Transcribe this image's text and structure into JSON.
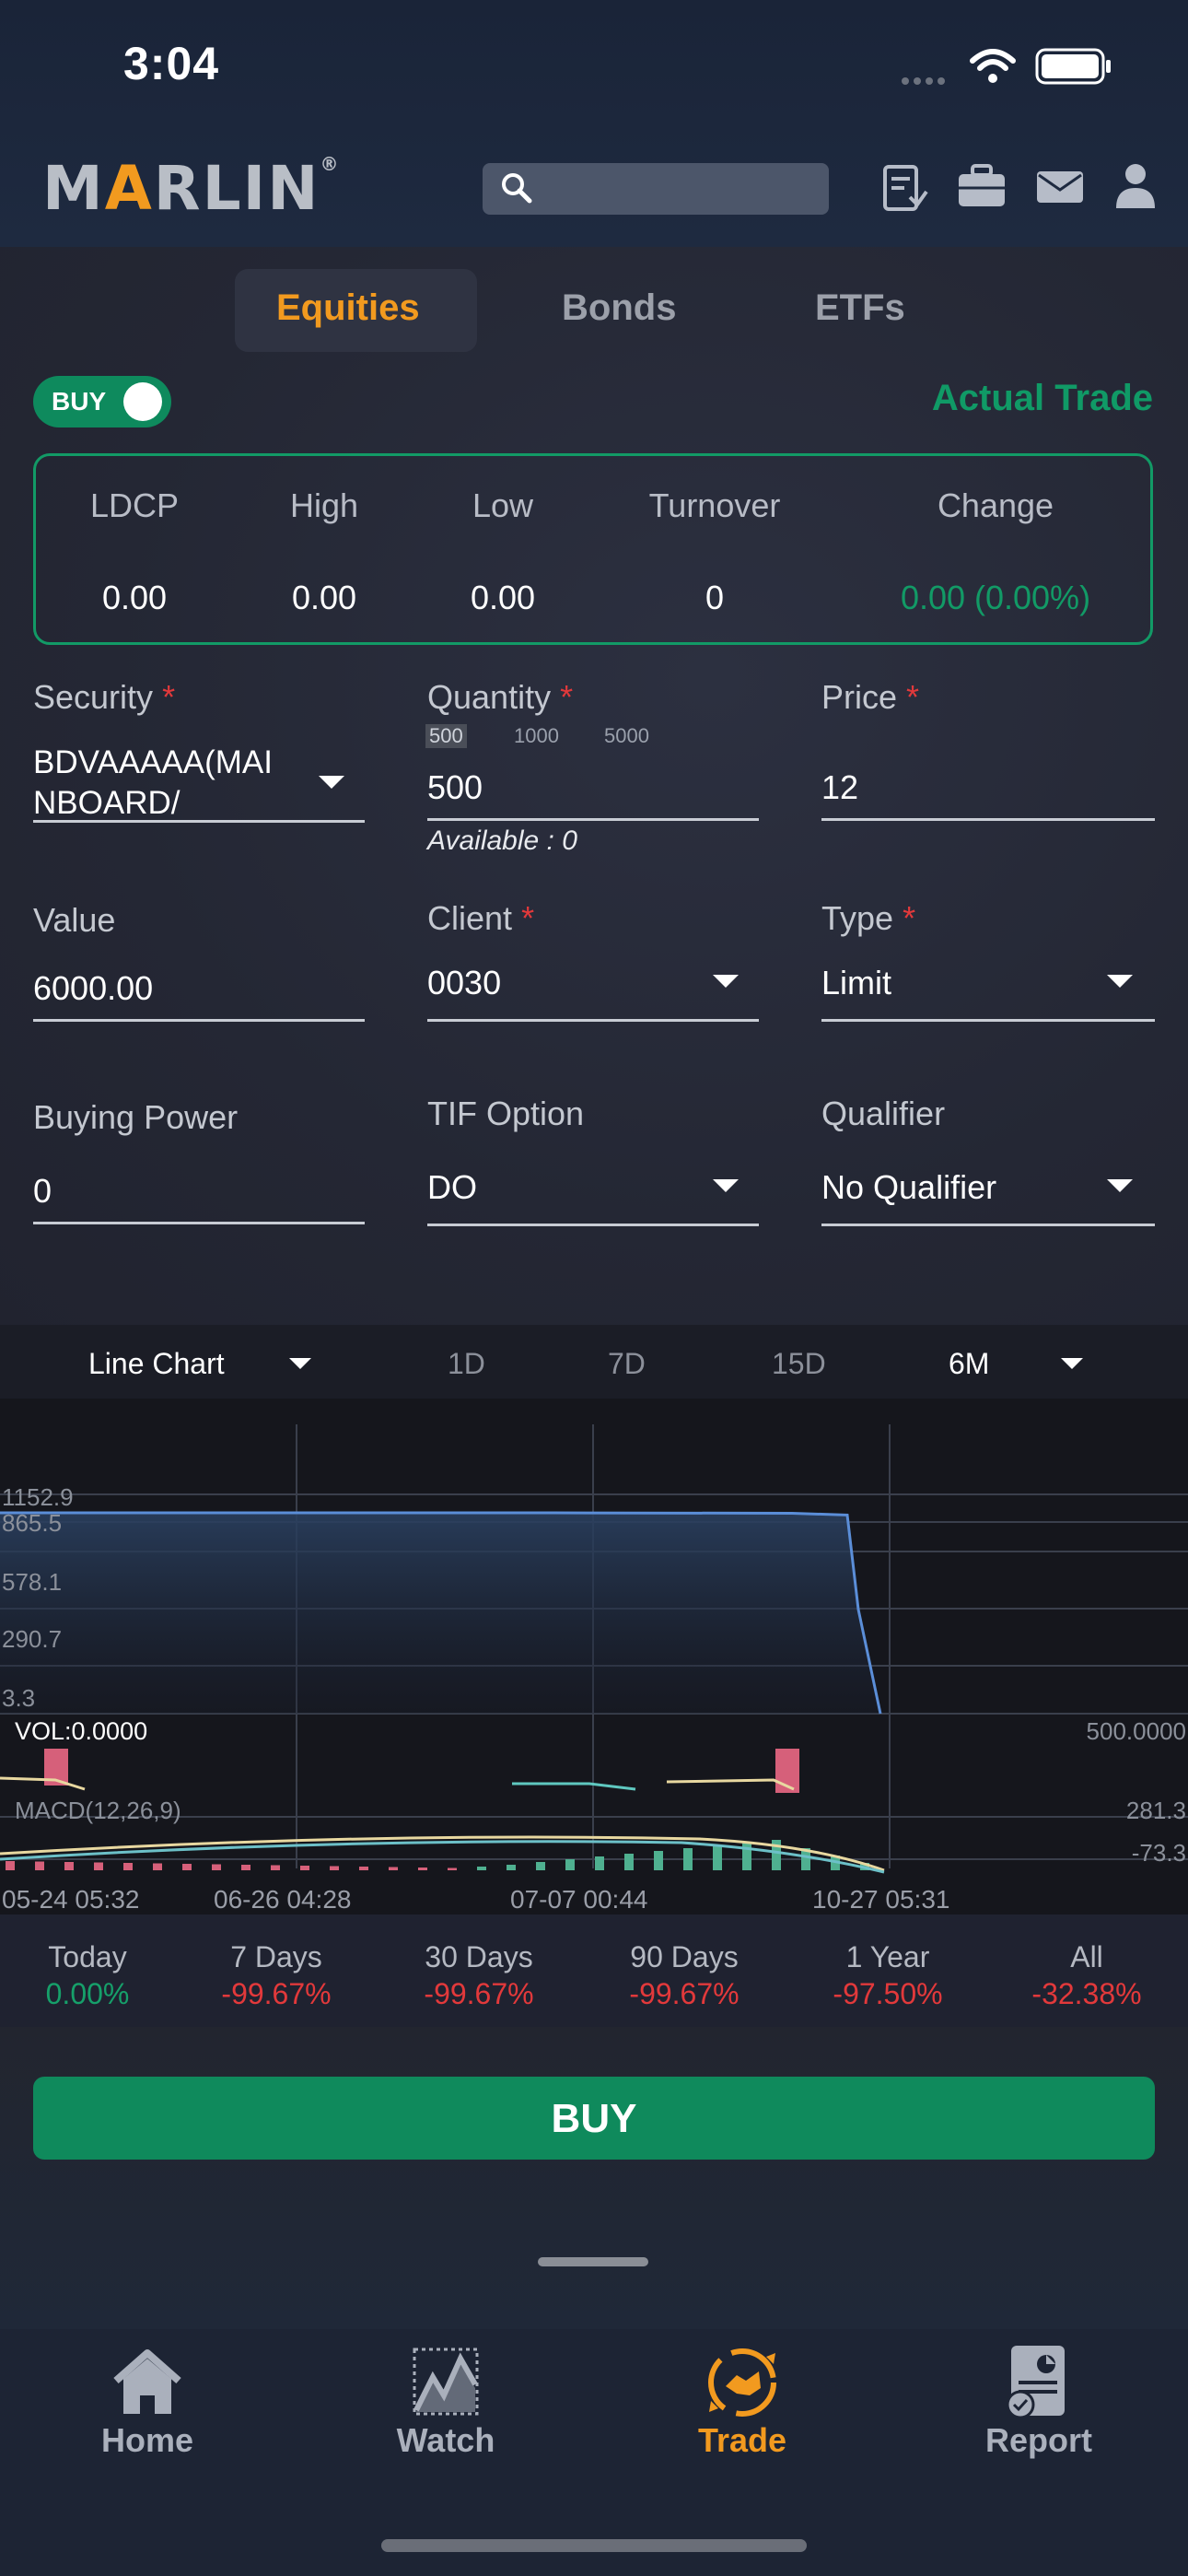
{
  "status": {
    "time": "3:04"
  },
  "header": {
    "logo_left": "M",
    "logo_a": "A",
    "logo_right": "RLIN",
    "logo_mark": "®",
    "search_placeholder": ""
  },
  "tabs": [
    {
      "label": "Equities",
      "active": true
    },
    {
      "label": "Bonds",
      "active": false
    },
    {
      "label": "ETFs",
      "active": false
    }
  ],
  "toggle": {
    "label": "BUY",
    "on": true
  },
  "trade_mode": "Actual Trade",
  "stats": {
    "headers": [
      "LDCP",
      "High",
      "Low",
      "Turnover",
      "Change"
    ],
    "values": [
      "0.00",
      "0.00",
      "0.00",
      "0",
      "0.00 (0.00%)"
    ]
  },
  "form": {
    "security": {
      "label": "Security",
      "value_line1": "BDVAAAAA(MAI",
      "value_line2": "NBOARD/"
    },
    "quantity": {
      "label": "Quantity",
      "value": "500",
      "chips": [
        "500",
        "1000",
        "5000"
      ],
      "available": "Available : 0"
    },
    "price": {
      "label": "Price",
      "value": "12"
    },
    "value": {
      "label": "Value",
      "value": "6000.00"
    },
    "client": {
      "label": "Client",
      "value": "0030"
    },
    "type": {
      "label": "Type",
      "value": "Limit"
    },
    "buying_power": {
      "label": "Buying Power",
      "value": "0"
    },
    "tif": {
      "label": "TIF Option",
      "value": "DO"
    },
    "qualifier": {
      "label": "Qualifier",
      "value": "No Qualifier"
    },
    "required_mark": "*"
  },
  "chart_controls": {
    "type": "Line Chart",
    "ranges": [
      "1D",
      "7D",
      "15D"
    ],
    "selected_range": "6M"
  },
  "chart_data": {
    "type": "line",
    "y_ticks": [
      "1152.9",
      "865.5",
      "578.1",
      "290.7",
      "3.3"
    ],
    "ylim": [
      3.3,
      1152.9
    ],
    "x_labels": [
      "05-24 05:32",
      "06-26 04:28",
      "07-07 00:44",
      "10-27 05:31"
    ],
    "series": [
      {
        "values": [
          1152.9,
          1152.9,
          1152.9,
          1152.9,
          1152.9,
          1152.9,
          1152.9,
          1150,
          1140,
          600,
          3.3
        ]
      }
    ],
    "volume_label": "VOL:0.0000",
    "volume_max": "500.0000",
    "macd_label": "MACD(12,26,9)",
    "macd_max": "281.3",
    "macd_min": "-73.3"
  },
  "performance": [
    {
      "label": "Today",
      "value": "0.00%",
      "color": "#16a06a"
    },
    {
      "label": "7 Days",
      "value": "-99.67%",
      "color": "#e2393b"
    },
    {
      "label": "30 Days",
      "value": "-99.67%",
      "color": "#e2393b"
    },
    {
      "label": "90 Days",
      "value": "-99.67%",
      "color": "#e2393b"
    },
    {
      "label": "1 Year",
      "value": "-97.50%",
      "color": "#e2393b"
    },
    {
      "label": "All",
      "value": "-32.38%",
      "color": "#e2393b"
    }
  ],
  "buy_button": "BUY",
  "nav": [
    {
      "label": "Home",
      "icon": "home-icon",
      "active": false
    },
    {
      "label": "Watch",
      "icon": "chart-icon",
      "active": false
    },
    {
      "label": "Trade",
      "icon": "trade-icon",
      "active": true
    },
    {
      "label": "Report",
      "icon": "report-icon",
      "active": false
    }
  ],
  "colors": {
    "accent": "#f29a1f",
    "green": "#0f8a5c",
    "red": "#e2393b"
  }
}
